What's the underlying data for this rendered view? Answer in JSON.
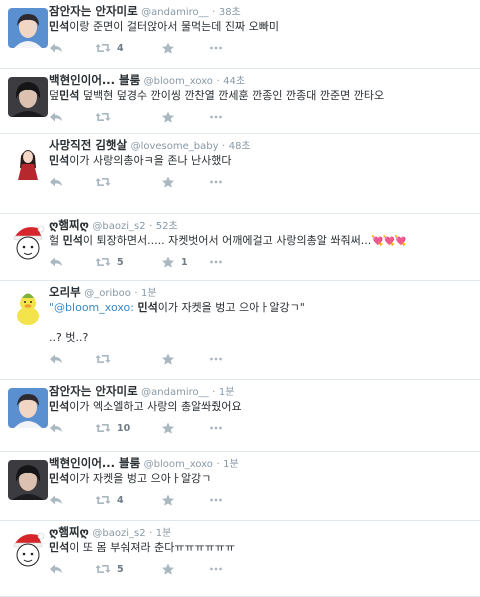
{
  "tweets": [
    {
      "name": "잠안자는 안자미로",
      "handle": "@andamiro__",
      "dot": "·",
      "time": "38초",
      "lines": [
        {
          "hl": "민석",
          "rest": "이랑 준면이 걸터앉아서 물먹는데 진짜 오빠미"
        }
      ],
      "retweets": "4",
      "favorites": ""
    },
    {
      "name": "백현인이어... 블룸",
      "handle": "@bloom_xoxo",
      "dot": "·",
      "time": "44초",
      "lines": [
        {
          "pre": "덮",
          "hl": "민석",
          "rest": " 덮백현 덮경수 깐이씽 깐찬열 깐세훈 깐종인 깐종대 깐준면 깐타오"
        }
      ],
      "retweets": "",
      "favorites": ""
    },
    {
      "name": "사망직전 김햇살",
      "handle": "@lovesome_baby",
      "dot": "·",
      "time": "48초",
      "lines": [
        {
          "hl": "민석",
          "rest": "이가 사랑의총아ㅋ을 존나 난사했다"
        }
      ],
      "retweets": "",
      "favorites": ""
    },
    {
      "name": "ღ햄찌ღ",
      "handle": "@baozi_s2",
      "dot": "·",
      "time": "52초",
      "lines": [
        {
          "pre": "헐 ",
          "hl": "민석",
          "rest": "이 퇴장하면서..... 자켓벗어서 어깨에걸고 사랑의총알 쏴줘써...",
          "hearts": "💘💘💘"
        }
      ],
      "retweets": "5",
      "favorites": "1"
    },
    {
      "name": "오리부",
      "handle": "@_oriboo",
      "dot": "·",
      "time": "1분",
      "lines": [
        {
          "link": "\"@bloom_xoxo:",
          "sp": " ",
          "hl": "민석",
          "rest": "이가 자켓을 벙고 으아ㅏ알강ㄱ\""
        },
        {
          "rest": ""
        },
        {
          "rest": "..? 벗..?"
        }
      ],
      "retweets": "",
      "favorites": ""
    },
    {
      "name": "잠안자는 안자미로",
      "handle": "@andamiro__",
      "dot": "·",
      "time": "1분",
      "lines": [
        {
          "hl": "민석",
          "rest": "이가 엑소엘하고 사랑의 총알쏴줬어요"
        }
      ],
      "retweets": "10",
      "favorites": ""
    },
    {
      "name": "백현인이어... 블룸",
      "handle": "@bloom_xoxo",
      "dot": "·",
      "time": "1분",
      "lines": [
        {
          "hl": "민석",
          "rest": "이가 자켓을 벙고 으아ㅏ알강ㄱ"
        }
      ],
      "retweets": "4",
      "favorites": ""
    },
    {
      "name": "ღ햄찌ღ",
      "handle": "@baozi_s2",
      "dot": "·",
      "time": "1분",
      "lines": [
        {
          "hl": "민석",
          "rest": "이 또 몸 부숴져라 춘다ㅠㅠㅠㅠㅠㅠ"
        }
      ],
      "retweets": "5",
      "favorites": ""
    }
  ],
  "icons": {
    "reply": "reply-icon",
    "retweet": "retweet-icon",
    "favorite": "star-icon",
    "more": "more-icon"
  },
  "colors": {
    "name": "#292f33",
    "meta": "#8899a6",
    "action": "#aab8c2",
    "link": "#3b88c3",
    "divider": "#e1e8ed"
  }
}
